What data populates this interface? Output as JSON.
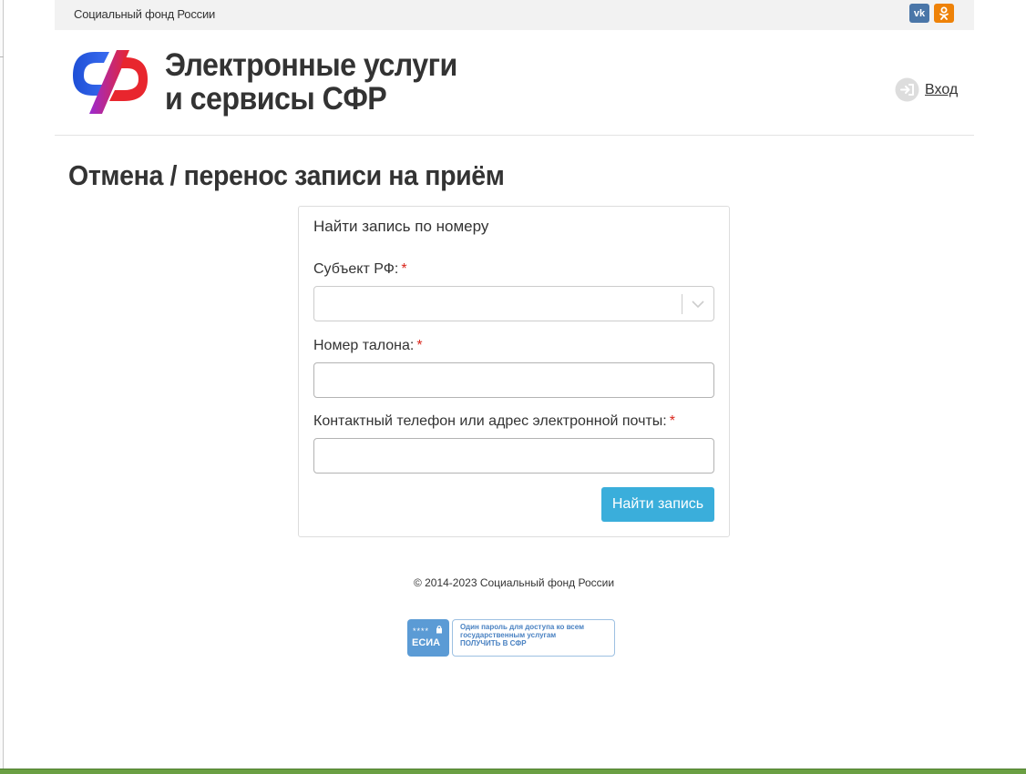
{
  "topbar": {
    "org_name": "Социальный фонд России",
    "social": [
      {
        "label": "vk",
        "icon": "vk-icon",
        "color": "#4a76a8"
      },
      {
        "label": "ok",
        "icon": "odnoklassniki-icon",
        "color": "#ee8208"
      }
    ]
  },
  "header": {
    "logo_icon": "sfr-logo-icon",
    "title_line1": "Электронные услуги",
    "title_line2": "и сервисы СФР",
    "login_label": "Вход",
    "login_icon": "login-icon"
  },
  "page": {
    "title": "Отмена / перенос записи на приём"
  },
  "form": {
    "panel_title": "Найти запись по номеру",
    "region_label": "Субъект РФ:",
    "region_value": "",
    "ticket_label": "Номер талона:",
    "ticket_value": "",
    "contact_label": "Контактный телефон или адрес электронной почты:",
    "contact_value": "",
    "required_mark": "*",
    "submit_label": "Найти запись"
  },
  "footer": {
    "copyright": "© 2014-2023 Социальный фонд России",
    "esia": {
      "stars": "****",
      "name": "ЕСИА",
      "line1": "Один пароль для доступа ко всем",
      "line2": "государственным услугам",
      "line3": "ПОЛУЧИТЬ В СФР"
    }
  },
  "colors": {
    "accent": "#3aaedb",
    "required": "#d9261c",
    "logo_blue": "#1e4fd6",
    "logo_red": "#e8262e"
  }
}
